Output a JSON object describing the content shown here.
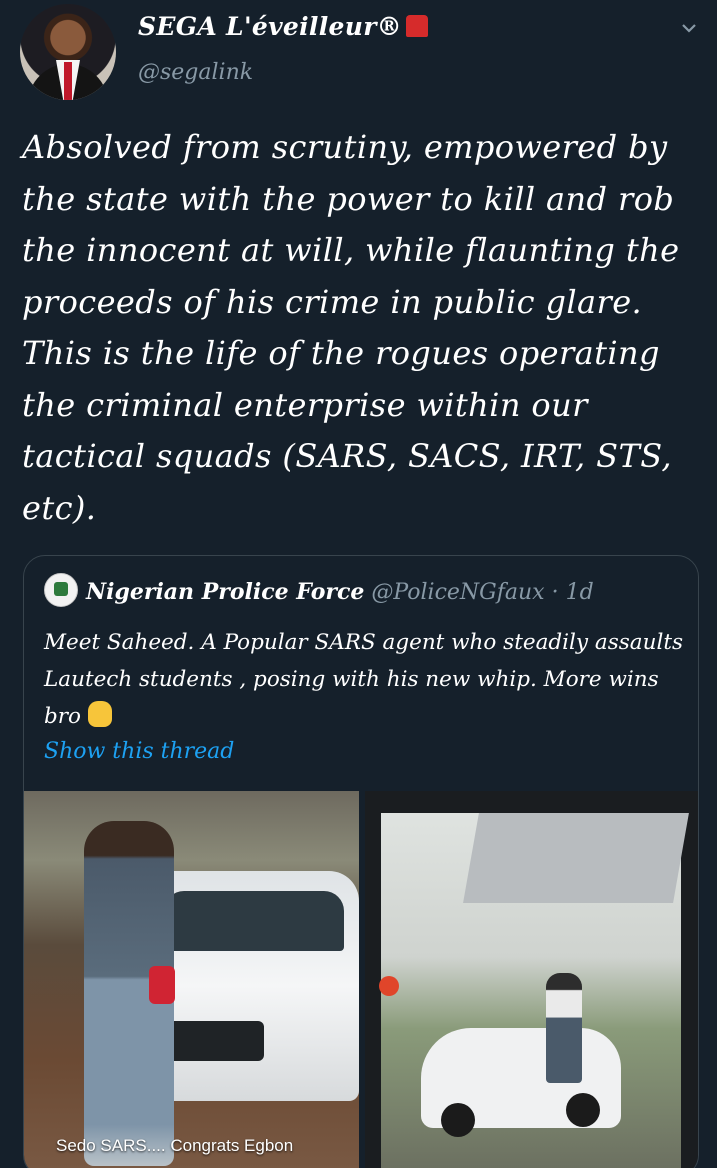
{
  "author": {
    "display_name": "SEGA L'éveilleur®",
    "handle": "@segalink"
  },
  "tweet": {
    "text": "Absolved from scrutiny, empowered by the state with the power to kill and rob the innocent at will, while flaunting the proceeds of his crime in public glare. This is the life of the rogues operating the criminal enterprise within our tactical squads (SARS, SACS, IRT, STS, etc)."
  },
  "quoted": {
    "display_name": "Nigerian Prolice Force",
    "handle": "@PoliceNGfaux",
    "time": "· 1d",
    "text": "Meet Saheed. A Popular SARS agent who steadily assaults Lautech students , posing with his new whip. More wins bro",
    "show_thread": "Show this thread",
    "photo_caption": "Sedo SARS.... Congrats Egbon"
  },
  "icons": {
    "siren": "siren-icon",
    "chevron": "chevron-down-icon",
    "ok_hand": "ok-hand-icon"
  },
  "colors": {
    "background": "#15202b",
    "secondary_text": "#8899a6",
    "link": "#1da1f2",
    "border": "#38444d"
  }
}
